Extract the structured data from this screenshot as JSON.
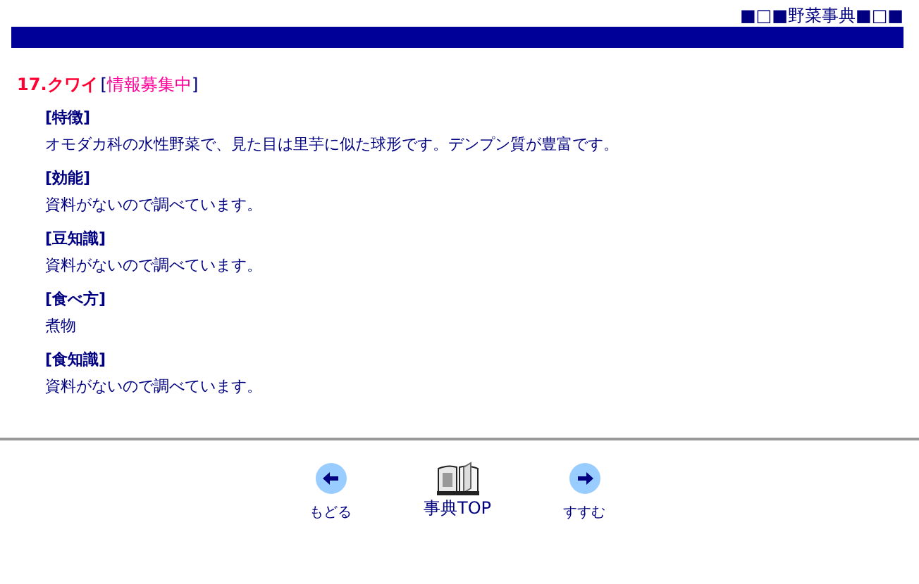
{
  "header": {
    "title": "■□■野菜事典■□■"
  },
  "entry": {
    "title": "17.クワイ",
    "status": "[情報募集中]"
  },
  "sections": [
    {
      "heading": "[特徴]",
      "body": "オモダカ科の水性野菜で、見た目は里芋に似た球形です。デンプン質が豊富です。"
    },
    {
      "heading": "[効能]",
      "body": "資料がないので調べています。"
    },
    {
      "heading": "[豆知識]",
      "body": "資料がないので調べています。"
    },
    {
      "heading": "[食べ方]",
      "body": "煮物"
    },
    {
      "heading": "[食知識]",
      "body": "資料がないので調べています。"
    }
  ],
  "nav": [
    {
      "kind": "back",
      "label": "もどる"
    },
    {
      "kind": "top",
      "label": "事典TOP"
    },
    {
      "kind": "forward",
      "label": "すすむ"
    }
  ]
}
